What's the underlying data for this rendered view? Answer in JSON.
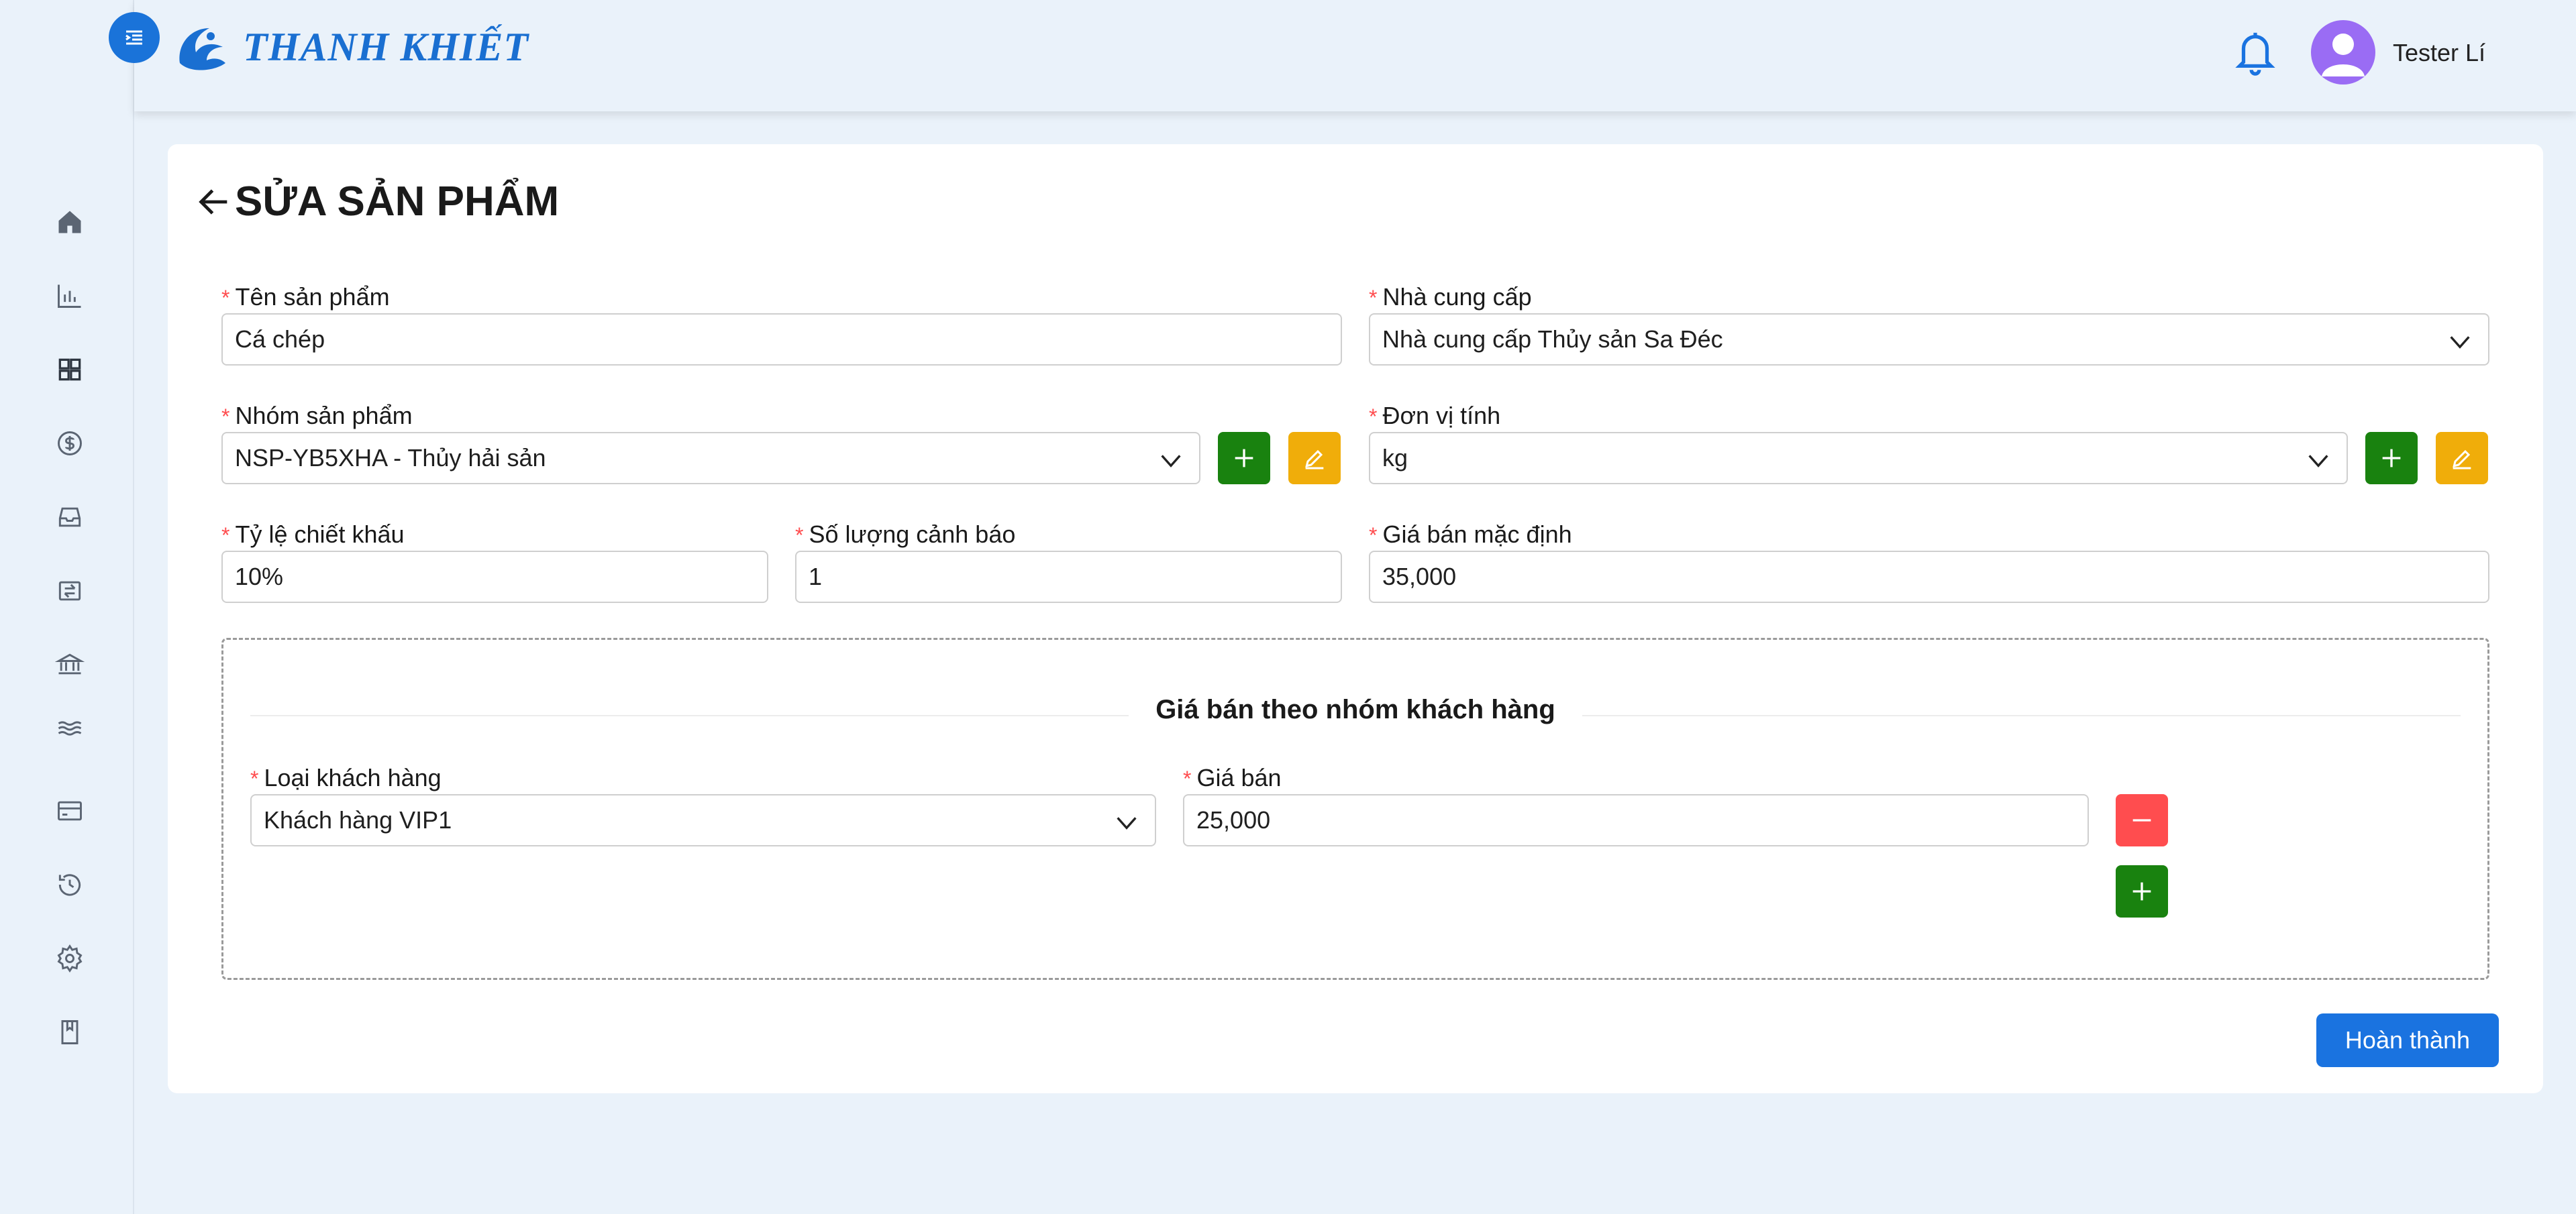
{
  "app": {
    "brand": "THANH KHIẾT",
    "colors": {
      "primary": "#1a73e0",
      "add": "#19820f",
      "edit": "#f0ad0a",
      "remove": "#ff4d4f",
      "avatar": "#9a6cf4"
    }
  },
  "header": {
    "username": "Tester Lí",
    "icons": [
      "menu-toggle-icon",
      "bell-icon",
      "user-avatar-icon"
    ]
  },
  "sidebar": {
    "items": [
      {
        "icon": "home-icon"
      },
      {
        "icon": "bar-chart-icon"
      },
      {
        "icon": "grid-icon"
      },
      {
        "icon": "dollar-icon"
      },
      {
        "icon": "inbox-icon"
      },
      {
        "icon": "transfer-icon"
      },
      {
        "icon": "bank-icon"
      },
      {
        "icon": "waves-icon"
      },
      {
        "icon": "card-icon"
      },
      {
        "icon": "history-icon"
      },
      {
        "icon": "settings-icon"
      },
      {
        "icon": "book-icon"
      }
    ]
  },
  "page": {
    "title": "SỬA SẢN PHẨM"
  },
  "form": {
    "product_name": {
      "label": "Tên sản phẩm",
      "value": "Cá chép"
    },
    "supplier": {
      "label": "Nhà cung cấp",
      "value": "Nhà cung cấp Thủy sản Sa Đéc"
    },
    "product_group": {
      "label": "Nhóm sản phẩm",
      "value": "NSP-YB5XHA - Thủy hải sản"
    },
    "unit": {
      "label": "Đơn vị tính",
      "value": "kg"
    },
    "discount_rate": {
      "label": "Tỷ lệ chiết khấu",
      "value": "10%"
    },
    "warning_qty": {
      "label": "Số lượng cảnh báo",
      "value": "1"
    },
    "default_price": {
      "label": "Giá bán mặc định",
      "value": "35,000"
    }
  },
  "customer_pricing": {
    "title": "Giá bán theo nhóm khách hàng",
    "customer_type_label": "Loại khách hàng",
    "price_label": "Giá bán",
    "rows": [
      {
        "customer_type": "Khách hàng VIP1",
        "price": "25,000"
      }
    ]
  },
  "actions": {
    "submit_label": "Hoàn thành"
  }
}
